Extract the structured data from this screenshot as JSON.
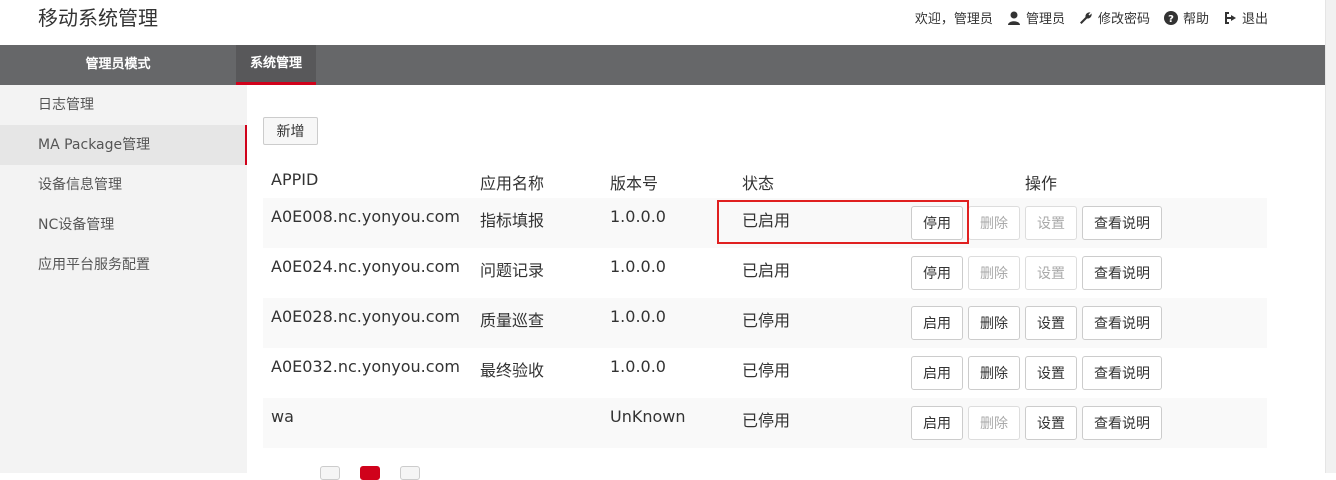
{
  "app": {
    "title": "移动系统管理"
  },
  "top_links": {
    "welcome": "欢迎，管理员",
    "user": "管理员",
    "change_password": "修改密码",
    "help": "帮助",
    "logout": "退出"
  },
  "nav": {
    "tabs": [
      "管理员模式",
      "系统管理"
    ],
    "active_tab": "系统管理"
  },
  "sidebar": {
    "items": [
      "日志管理",
      "MA Package管理",
      "设备信息管理",
      "NC设备管理",
      "应用平台服务配置"
    ],
    "active_item": "MA Package管理"
  },
  "toolbar": {
    "add_label": "新增"
  },
  "table": {
    "headers": {
      "appid": "APPID",
      "name": "应用名称",
      "version": "版本号",
      "status": "状态",
      "ops": "操作"
    },
    "rows": [
      {
        "appid": "A0E008.nc.yonyou.com",
        "name": "指标填报",
        "version": "1.0.0.0",
        "status": "已启用",
        "toggle": "停用",
        "delete": "删除",
        "settings": "设置",
        "view": "查看说明",
        "delete_enabled": false,
        "settings_enabled": false
      },
      {
        "appid": "A0E024.nc.yonyou.com",
        "name": "问题记录",
        "version": "1.0.0.0",
        "status": "已启用",
        "toggle": "停用",
        "delete": "删除",
        "settings": "设置",
        "view": "查看说明",
        "delete_enabled": false,
        "settings_enabled": false
      },
      {
        "appid": "A0E028.nc.yonyou.com",
        "name": "质量巡查",
        "version": "1.0.0.0",
        "status": "已停用",
        "toggle": "启用",
        "delete": "删除",
        "settings": "设置",
        "view": "查看说明",
        "delete_enabled": true,
        "settings_enabled": true
      },
      {
        "appid": "A0E032.nc.yonyou.com",
        "name": "最终验收",
        "version": "1.0.0.0",
        "status": "已停用",
        "toggle": "启用",
        "delete": "删除",
        "settings": "设置",
        "view": "查看说明",
        "delete_enabled": true,
        "settings_enabled": true
      },
      {
        "appid": "wa",
        "name": "",
        "version": "UnKnown",
        "status": "已停用",
        "toggle": "启用",
        "delete": "删除",
        "settings": "设置",
        "view": "查看说明",
        "delete_enabled": false,
        "settings_enabled": true
      }
    ]
  },
  "colors": {
    "accent": "#d0021b",
    "navbar": "#666769",
    "highlight": "#e02020"
  }
}
